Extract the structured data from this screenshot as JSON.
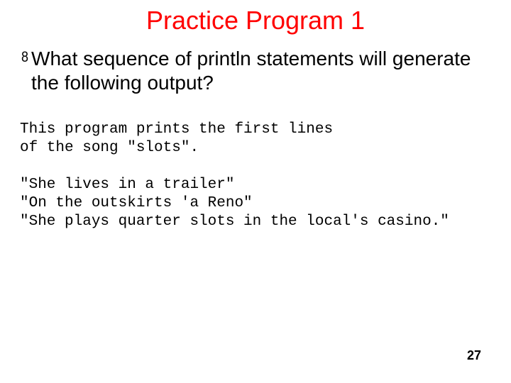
{
  "title": "Practice Program 1",
  "bullet": {
    "marker": "8",
    "text": "What sequence of println statements will generate the following output?"
  },
  "code": "This program prints the first lines\nof the song \"slots\".\n\n\"She lives in a trailer\"\n\"On the outskirts 'a Reno\"\n\"She plays quarter slots in the local's casino.\"",
  "page_number": "27"
}
